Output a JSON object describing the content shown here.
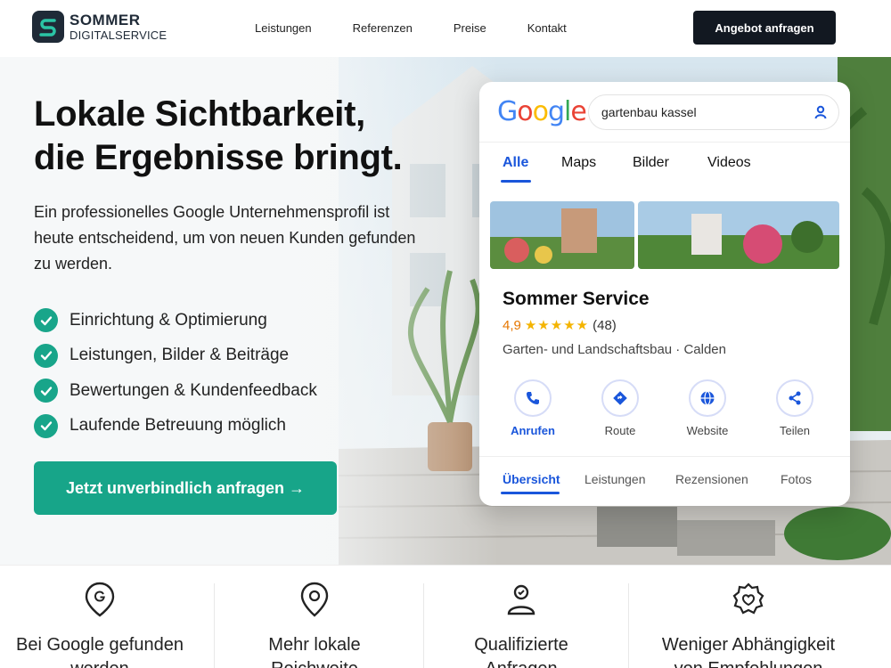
{
  "brand": {
    "line1": "SOMMER",
    "line2": "DIGITALSERVICE",
    "color": "#1f2a37",
    "accent": "#18a58a"
  },
  "nav": {
    "items": [
      "Leistungen",
      "Referenzen",
      "Preise",
      "Kontakt"
    ],
    "cta": "Angebot anfragen"
  },
  "hero": {
    "headline_line1": "Lokale Sichtbarkeit,",
    "headline_line2": "die Ergebnisse bringt.",
    "subtitle": "Ein professionelles Google Unternehmensprofil ist heute entscheidend, um von neuen Kunden gefunden zu werden.",
    "checks": [
      "Einrichtung & Optimierung",
      "Leistungen, Bilder & Beiträge",
      "Bewertungen & Kundenfeedback",
      "Laufende Betreuung möglich"
    ],
    "cta": "Jetzt unverbindlich anfragen →"
  },
  "google_card": {
    "search_value": "gartenbau kassel",
    "tabs": [
      "Alle",
      "Maps",
      "Bilder",
      "Videos"
    ],
    "active_tab": "Alle",
    "business_name": "Sommer Service",
    "rating": "4,9",
    "stars": "★★★★★",
    "review_count": "(48)",
    "category": "Garten- und Landschaftsbau · Calden",
    "actions": [
      {
        "label": "Anrufen",
        "icon": "phone-icon"
      },
      {
        "label": "Route",
        "icon": "directions-icon"
      },
      {
        "label": "Website",
        "icon": "globe-icon"
      },
      {
        "label": "Teilen",
        "icon": "share-icon"
      }
    ],
    "bottom_tabs": [
      "Übersicht",
      "Leistungen",
      "Rezensionen",
      "Fotos"
    ],
    "active_bottom_tab": "Übersicht"
  },
  "features": [
    {
      "line1": "Bei Google gefunden",
      "line2": "werden",
      "icon": "google-pin-icon"
    },
    {
      "line1": "Mehr lokale",
      "line2": "Reichweite",
      "icon": "location-pin-icon"
    },
    {
      "line1": "Qualifizierte",
      "line2": "Anfragen",
      "icon": "user-icon"
    },
    {
      "line1": "Weniger Abhängigkeit",
      "line2": "von Empfehlungen",
      "icon": "settings-icon"
    }
  ]
}
